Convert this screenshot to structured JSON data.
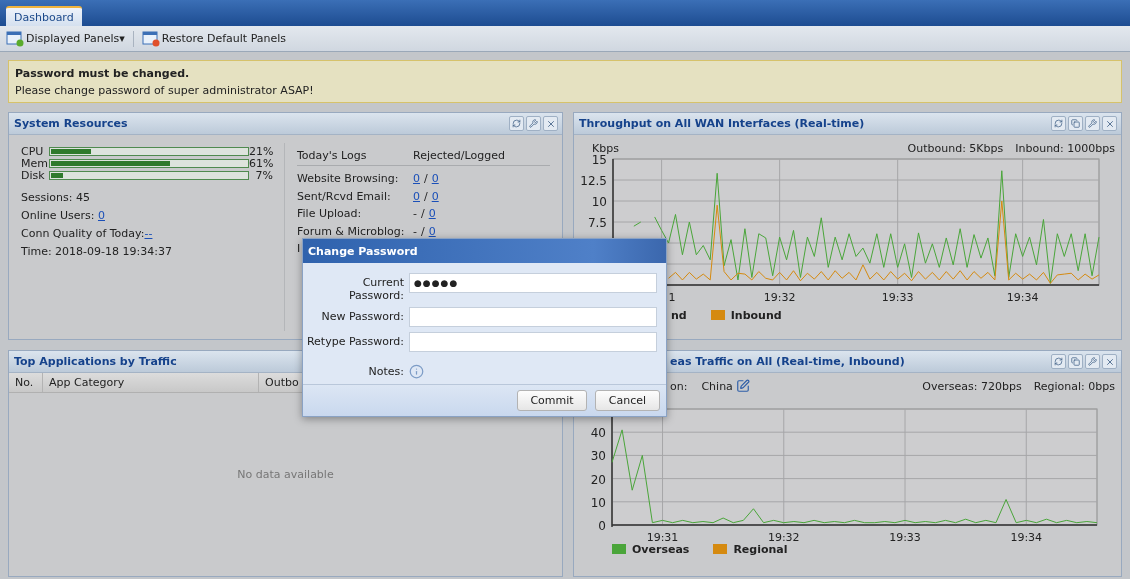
{
  "tabs": [
    {
      "label": "Dashboard",
      "selected": true
    }
  ],
  "toolbar": {
    "items": [
      {
        "label": "Displayed Panels",
        "kind": "dropdown",
        "caret": "▾"
      },
      {
        "label": "Restore Default Panels",
        "kind": "button"
      }
    ]
  },
  "alert": {
    "title": "Password must be changed.",
    "message": "Please change password of super administrator ASAP!"
  },
  "system_resources": {
    "title": "System Resources",
    "meters": [
      {
        "label": "CPU",
        "level": 0.21,
        "reading": "21%"
      },
      {
        "label": "Mem",
        "level": 0.61,
        "reading": "61%"
      },
      {
        "label": "Disk",
        "level": 0.07,
        "reading": "7%"
      }
    ],
    "stats": [
      {
        "label": "Sessions: 45"
      },
      {
        "label": "Online Users: ",
        "link": "0"
      },
      {
        "label": "Conn Quality of Today:",
        "link": "--"
      },
      {
        "label": "Time: 2018-09-18 19:34:37"
      }
    ],
    "logs": {
      "columns": [
        "Today's Logs",
        "Rejected/Logged"
      ],
      "rows": [
        {
          "label": "Website Browsing:",
          "rejected": "0",
          "rejected_link": true,
          "separator": "/",
          "logged": "0"
        },
        {
          "label": "Sent/Rcvd Email:",
          "rejected": "0",
          "rejected_link": true,
          "separator": "/",
          "logged": "0"
        },
        {
          "label": "File Upload:",
          "rejected": "-",
          "rejected_link": false,
          "separator": "/",
          "logged": "0"
        },
        {
          "label": "Forum & Microblog:",
          "rejected": "-",
          "rejected_link": false,
          "separator": "/",
          "logged": "0"
        },
        {
          "label": "I"
        }
      ]
    }
  },
  "throughput": {
    "title": "Throughput on All WAN Interfaces (Real-time)",
    "readings": [
      "Outbound: 5Kbps",
      "Inbound: 1000bps"
    ],
    "legend": [
      {
        "swatch": false
      },
      {
        "swatch": true
      }
    ],
    "cut_tick_label": "1",
    "chart_data": {
      "type": "line",
      "ylabel": "Kbps",
      "grid": true,
      "ylim": [
        0,
        15
      ],
      "yticks": [
        7.5,
        10,
        12.5,
        15
      ],
      "categories": [
        null,
        null,
        null,
        null,
        null,
        null,
        null,
        null,
        null,
        null,
        null,
        null,
        null,
        null,
        null,
        null,
        null,
        null,
        null,
        null,
        null,
        null,
        null,
        null,
        "19:32",
        null,
        null,
        null,
        null,
        null,
        null,
        null,
        null,
        null,
        null,
        null,
        null,
        null,
        null,
        null,
        null,
        "19:33",
        null,
        null,
        null,
        null,
        null,
        null,
        null,
        null,
        null,
        null,
        null,
        null,
        null,
        null,
        null,
        null,
        null,
        "19:34",
        null,
        null,
        null,
        null,
        null,
        null,
        null,
        null,
        null,
        null,
        null
      ],
      "series": [
        {
          "name": "nd",
          "color": "#4aa53a",
          "values": [
            null,
            null,
            null,
            7,
            7.5,
            null,
            8.1,
            6.5,
            5,
            8.4,
            3.6,
            7.5,
            3.6,
            4.7,
            3,
            13.3,
            2.3,
            5.4,
            0.6,
            6.7,
            0.9,
            6.1,
            5.6,
            1.1,
            5.7,
            3,
            6.5,
            0.9,
            5.7,
            3.4,
            8,
            2.1,
            5.7,
            3,
            6.1,
            3.4,
            4.4,
            2.6,
            6.1,
            2.1,
            6.1,
            2.1,
            4.9,
            0.9,
            6.2,
            2.6,
            4.9,
            2.1,
            5.6,
            2.4,
            6.7,
            2.1,
            6,
            3.2,
            5.6,
            1.1,
            13.6,
            0.9,
            6.1,
            3.4,
            5.7,
            2.4,
            7.8,
            0.2,
            6.1,
            3.4,
            6.1,
            1.7,
            6.1,
            1.1,
            5.7
          ]
        },
        {
          "name": "Inbound",
          "color": "#d58a10",
          "values": [
            null,
            null,
            null,
            null,
            null,
            null,
            null,
            null,
            0.8,
            1.5,
            0.6,
            1.5,
            0.7,
            1.3,
            0.6,
            9.5,
            1.6,
            0.6,
            1.4,
            1.3,
            0.6,
            1.6,
            0.8,
            0.6,
            1.5,
            0.6,
            1.7,
            0.5,
            1.4,
            0.7,
            1.6,
            0.6,
            1.7,
            0.8,
            1.5,
            0.6,
            2.4,
            0.7,
            1.5,
            0.6,
            1.6,
            0.7,
            1.4,
            0.5,
            1.6,
            0.7,
            1.5,
            0.6,
            1.6,
            0.7,
            1.7,
            0.6,
            1.6,
            0.8,
            1.5,
            0.6,
            10,
            0.6,
            1.4,
            0.7,
            1.3,
            0.6,
            1.5,
            0.2,
            1.2,
            1.3,
            1.4,
            0.6,
            1.3,
            0.7,
            1.2
          ]
        }
      ]
    }
  },
  "top_apps": {
    "title": "Top Applications by Traffic",
    "columns": [
      "No.",
      "App Category",
      "Outbo"
    ],
    "empty": "No data available"
  },
  "overseas": {
    "title": "eas Traffic on All (Real-time, Inbound)",
    "region_label": "on:",
    "region": "China",
    "readings": [
      "Overseas: 720bps",
      "Regional: 0bps"
    ],
    "legend": [
      {
        "swatch": true
      },
      {
        "swatch": true
      }
    ],
    "chart_data": {
      "type": "line",
      "grid": true,
      "ylim": [
        0,
        50
      ],
      "yticks": [
        0,
        10,
        20,
        30,
        40
      ],
      "categories": [
        null,
        null,
        null,
        null,
        null,
        "19:31",
        null,
        null,
        null,
        null,
        null,
        null,
        null,
        null,
        null,
        null,
        null,
        "19:32",
        null,
        null,
        null,
        null,
        null,
        null,
        null,
        null,
        null,
        null,
        null,
        "19:33",
        null,
        null,
        null,
        null,
        null,
        null,
        null,
        null,
        null,
        null,
        null,
        "19:34",
        null,
        null,
        null,
        null,
        null,
        null,
        null
      ],
      "series": [
        {
          "name": "Overseas",
          "color": "#4aa53a",
          "values": [
            27,
            41,
            15,
            30,
            1,
            2,
            1,
            2,
            1,
            1.5,
            1,
            3,
            1,
            2,
            7,
            1,
            2,
            1,
            1.5,
            1,
            2,
            1,
            1.5,
            1,
            2,
            1,
            1,
            1.5,
            1,
            2,
            1,
            1.5,
            1,
            2,
            1,
            2.5,
            1,
            2,
            1,
            11,
            1,
            2,
            1,
            2.5,
            1,
            2,
            1,
            1.5,
            1
          ]
        },
        {
          "name": "Regional",
          "color": "#d58a10",
          "values": [
            null,
            null,
            null,
            null,
            null,
            null,
            null,
            null,
            null,
            null,
            null,
            null,
            null,
            null,
            null,
            null,
            null,
            null,
            null,
            null,
            null,
            null,
            null,
            null,
            null,
            null,
            null,
            null,
            null,
            null,
            null,
            null,
            null,
            null,
            null,
            null,
            null,
            null,
            null,
            null,
            null,
            null,
            null,
            null,
            null,
            null,
            null,
            null,
            null
          ]
        }
      ]
    }
  },
  "dialog": {
    "title": "Change Password",
    "fields": [
      {
        "label": "Current Password:",
        "value": "●●●●●"
      },
      {
        "label": "New Password:"
      },
      {
        "label": "Retype Password:"
      }
    ],
    "notes_label": "Notes:",
    "buttons": [
      "Commit",
      "Cancel"
    ]
  }
}
